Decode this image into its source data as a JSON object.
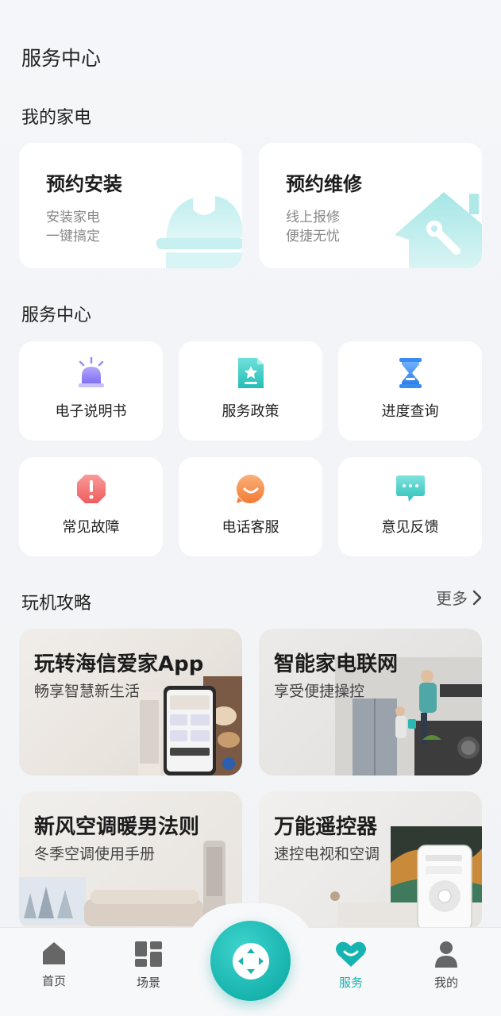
{
  "header": {
    "title": "服务中心"
  },
  "appliances": {
    "section_title": "我的家电",
    "install": {
      "title": "预约安装",
      "line1": "安装家电",
      "line2": "一键搞定",
      "icon": "hardhat-icon"
    },
    "repair": {
      "title": "预约维修",
      "line1": "线上报修",
      "line2": "便捷无忧",
      "icon": "house-wrench-icon"
    }
  },
  "services": {
    "section_title": "服务中心",
    "items": [
      {
        "label": "电子说明书",
        "icon": "alarm-light-icon",
        "color": "#8b7cf6"
      },
      {
        "label": "服务政策",
        "icon": "document-star-icon",
        "color": "#2fc7c0"
      },
      {
        "label": "进度查询",
        "icon": "hourglass-icon",
        "color": "#3b8df0"
      },
      {
        "label": "常见故障",
        "icon": "warning-icon",
        "color": "#f36a6a"
      },
      {
        "label": "电话客服",
        "icon": "smile-chat-icon",
        "color": "#f5873a"
      },
      {
        "label": "意见反馈",
        "icon": "chat-bubble-icon",
        "color": "#2fc7c0"
      }
    ]
  },
  "guides": {
    "section_title": "玩机攻略",
    "more_label": "更多",
    "items": [
      {
        "title": "玩转海信爱家App",
        "subtitle": "畅享智慧新生活"
      },
      {
        "title": "智能家电联网",
        "subtitle": "享受便捷操控"
      },
      {
        "title": "新风空调暖男法则",
        "subtitle": "冬季空调使用手册"
      },
      {
        "title": "万能遥控器",
        "subtitle": "速控电视和空调"
      }
    ]
  },
  "tabbar": {
    "items": [
      {
        "label": "首页",
        "icon": "home-icon"
      },
      {
        "label": "场景",
        "icon": "scene-grid-icon"
      },
      {
        "label": "服务",
        "icon": "heart-service-icon",
        "active": true
      },
      {
        "label": "我的",
        "icon": "user-icon"
      }
    ],
    "center_icon": "remote-control-icon",
    "active_color": "#17b3b0"
  }
}
